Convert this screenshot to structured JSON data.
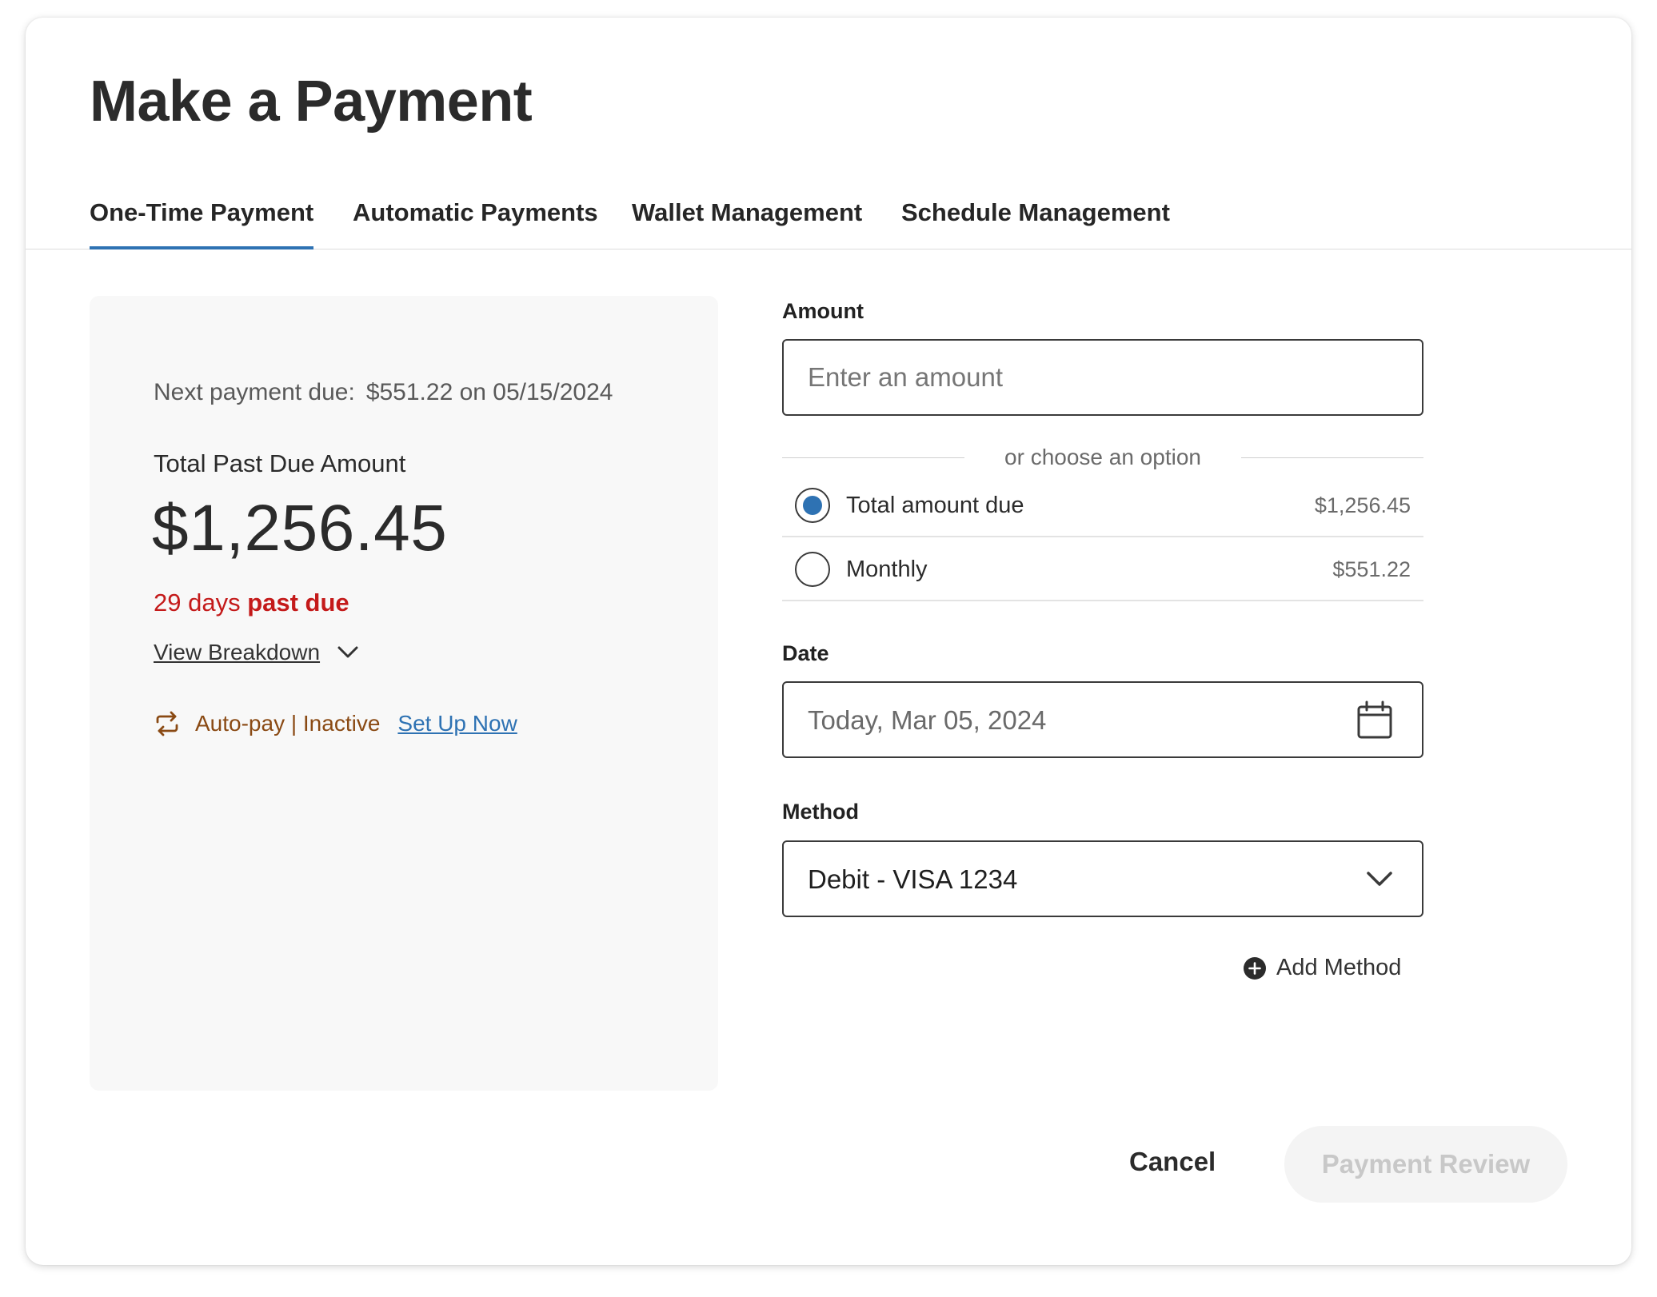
{
  "page": {
    "title": "Make a Payment"
  },
  "tabs": [
    {
      "label": "One-Time Payment",
      "active": true
    },
    {
      "label": "Automatic Payments",
      "active": false
    },
    {
      "label": "Wallet Management",
      "active": false
    },
    {
      "label": "Schedule Management",
      "active": false
    }
  ],
  "summary": {
    "next_due_label": "Next payment due:",
    "next_due_value": "$551.22 on 05/15/2024",
    "past_due_label": "Total Past Due Amount",
    "past_due_amount": "$1,256.45",
    "days_text": "29 days",
    "past_due_text": "past due",
    "view_breakdown": "View Breakdown",
    "autopay_status": "Auto-pay | Inactive",
    "setup_link": "Set Up Now"
  },
  "form": {
    "amount_label": "Amount",
    "amount_placeholder": "Enter an amount",
    "amount_value": "",
    "divider_text": "or choose an option",
    "options": [
      {
        "label": "Total amount due",
        "value": "$1,256.45",
        "selected": true
      },
      {
        "label": "Monthly",
        "value": "$551.22",
        "selected": false
      }
    ],
    "date_label": "Date",
    "date_value": "Today, Mar 05, 2024",
    "method_label": "Method",
    "method_value": "Debit - VISA 1234",
    "add_method": "Add Method"
  },
  "actions": {
    "cancel": "Cancel",
    "review": "Payment Review",
    "review_enabled": false
  },
  "colors": {
    "accent": "#2e72b3",
    "past_due": "#c41a1a",
    "autopay": "#8a4a14",
    "disabled_text": "#c8c8c8"
  },
  "icons": {
    "autopay": "repeat-icon",
    "breakdown": "chevron-down-icon",
    "date": "calendar-icon",
    "method": "chevron-down-icon",
    "add": "plus-circle-icon"
  }
}
